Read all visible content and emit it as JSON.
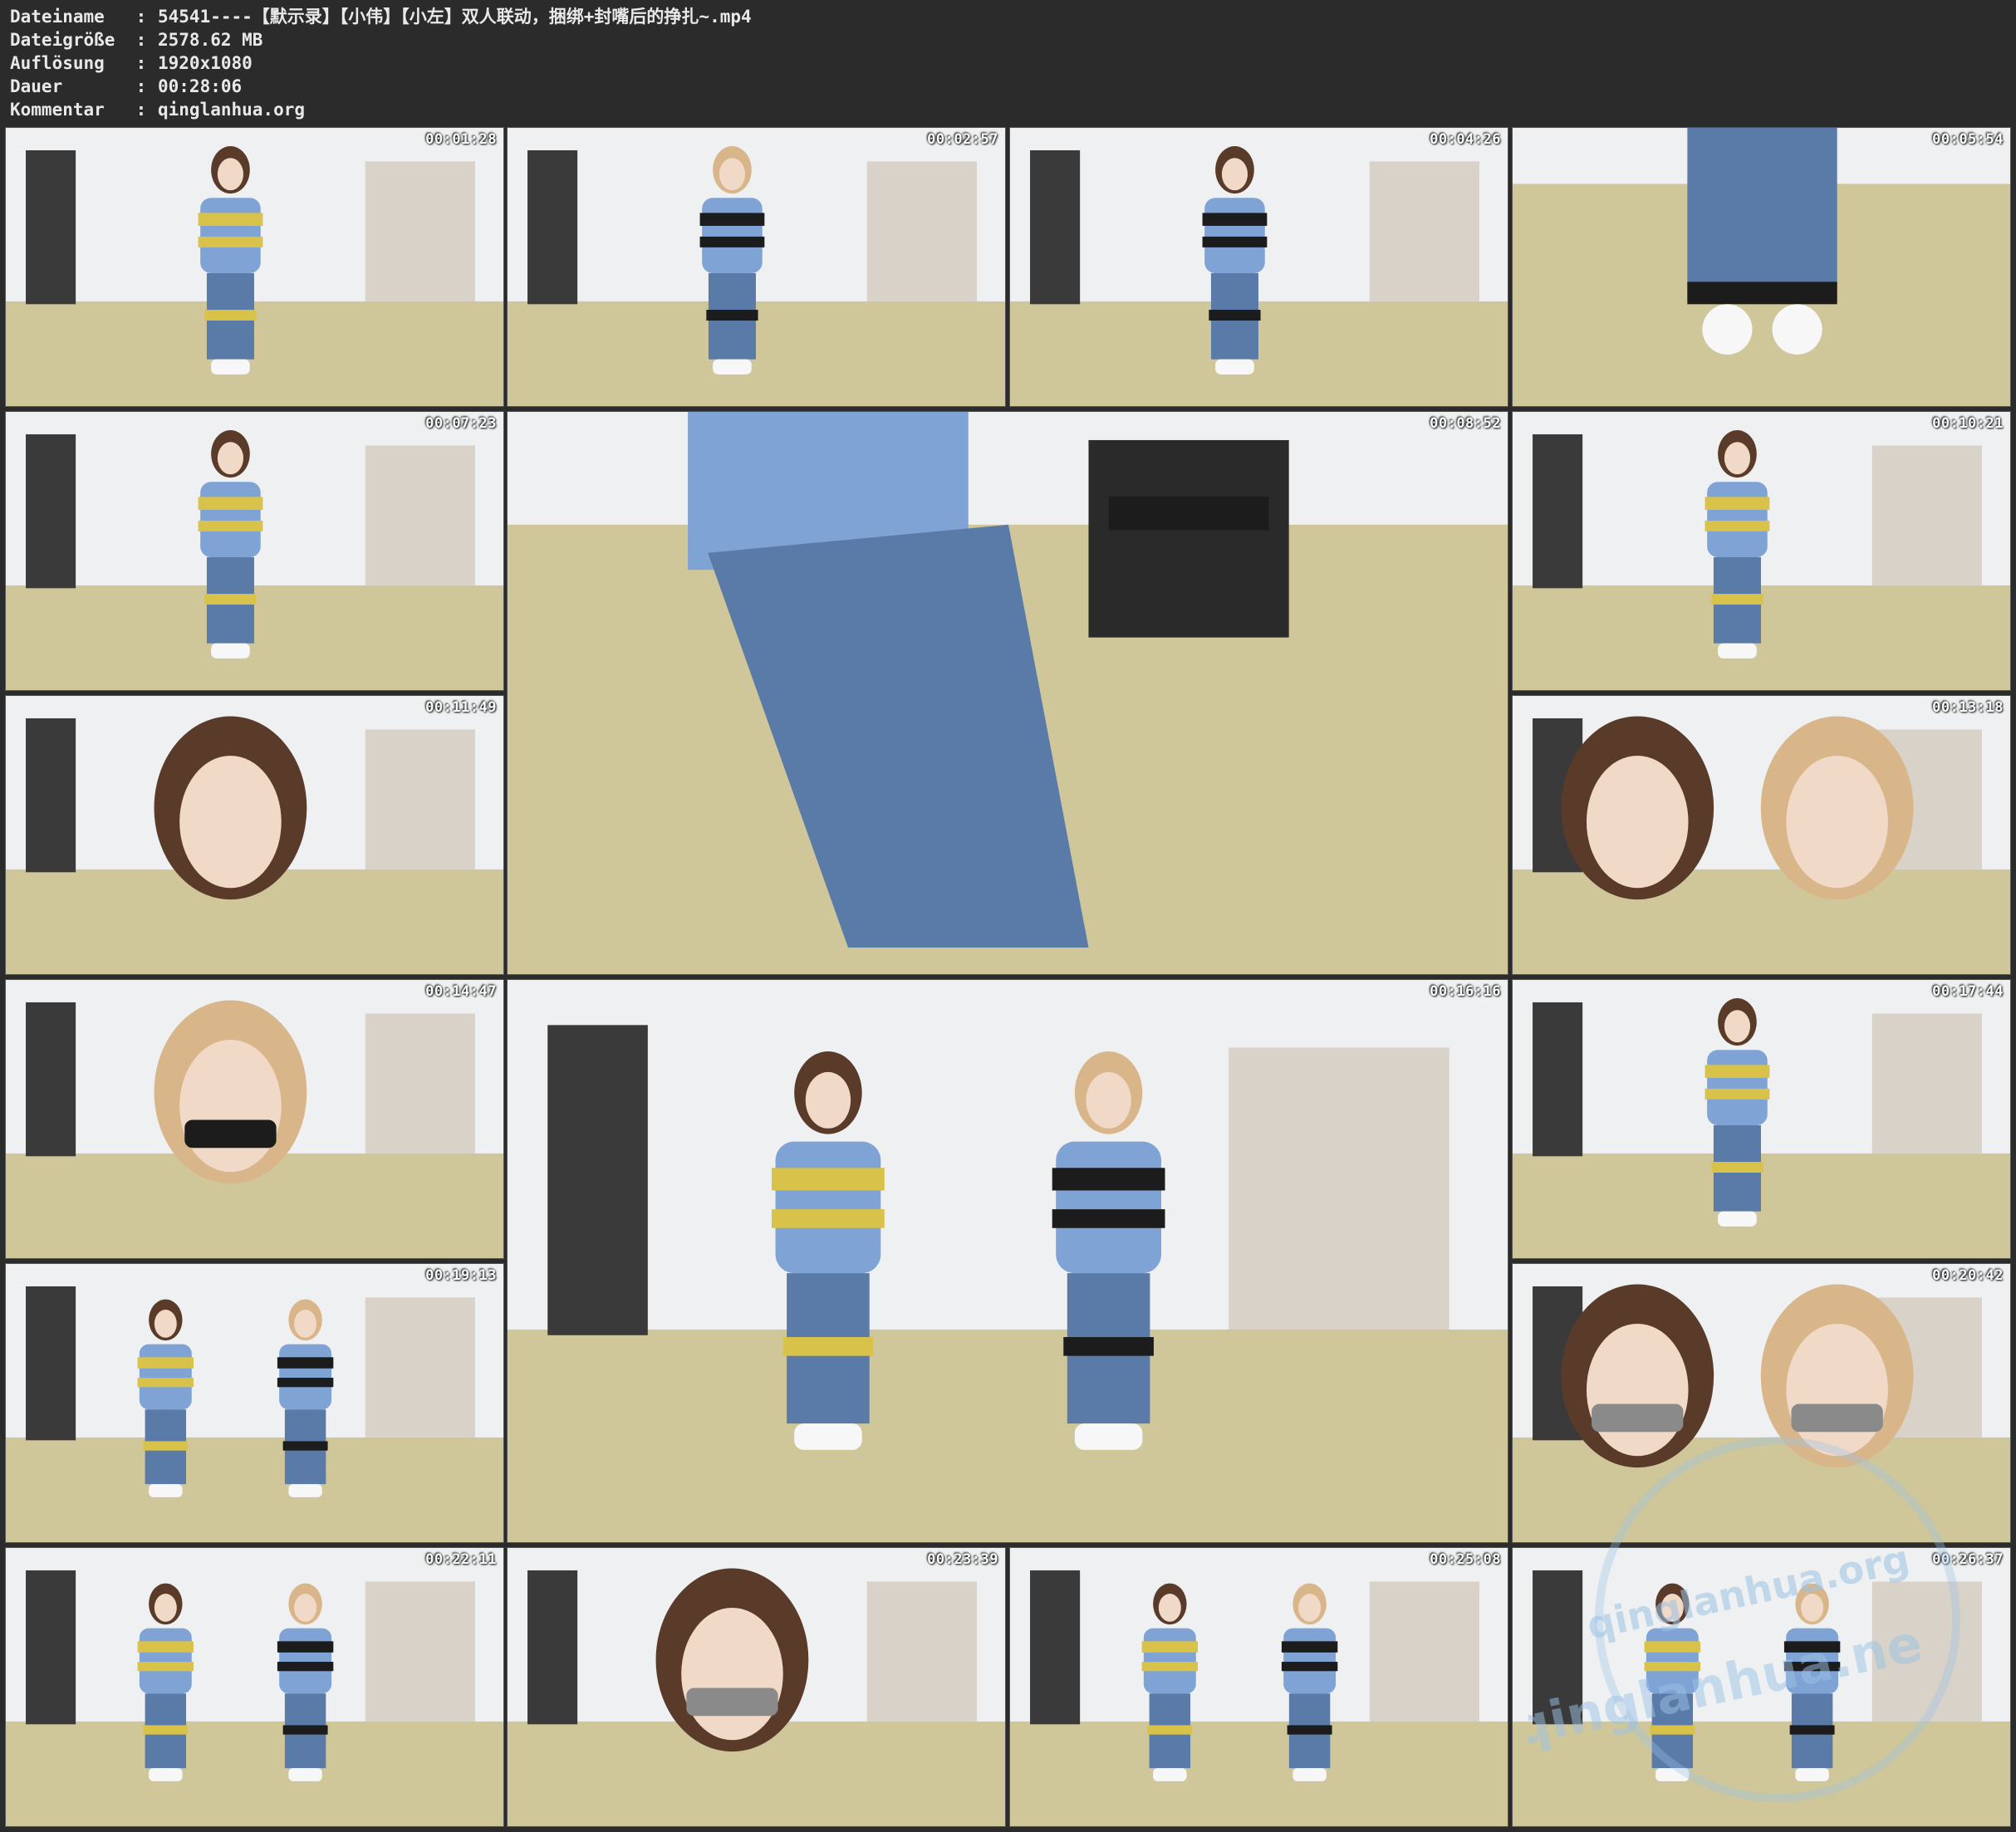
{
  "metadata": [
    {
      "key": "Dateiname",
      "value": "54541----【默示录】【小伟】【小左】双人联动，捆绑+封嘴后的挣扎~.mp4"
    },
    {
      "key": "Dateigröße",
      "value": "2578.62 MB"
    },
    {
      "key": "Auflösung",
      "value": "1920x1080"
    },
    {
      "key": "Dauer",
      "value": "00:28:06"
    },
    {
      "key": "Kommentar",
      "value": "qinglanhua.org"
    }
  ],
  "separator": ":",
  "thumbnails": [
    {
      "timestamp": "00:01:28",
      "scene": "hair-styling"
    },
    {
      "timestamp": "00:02:57",
      "scene": "seated-black-wrap"
    },
    {
      "timestamp": "00:04:26",
      "scene": "leg-taping"
    },
    {
      "timestamp": "00:05:54",
      "scene": "feet-closeup"
    },
    {
      "timestamp": "00:07:23",
      "scene": "yellow-wrap"
    },
    {
      "timestamp": "00:08:52",
      "scene": "jeans-closeup"
    },
    {
      "timestamp": "00:10:21",
      "scene": "knee-yellow-tape"
    },
    {
      "timestamp": "00:11:49",
      "scene": "face-closeup"
    },
    {
      "timestamp": "00:13:18",
      "scene": "two-faces"
    },
    {
      "timestamp": "00:14:47",
      "scene": "mouth-taping"
    },
    {
      "timestamp": "00:16:16",
      "scene": "two-seated-wide"
    },
    {
      "timestamp": "00:17:44",
      "scene": "lap-yellow-tape"
    },
    {
      "timestamp": "00:19:13",
      "scene": "two-seated-wide"
    },
    {
      "timestamp": "00:20:42",
      "scene": "two-faces-taped"
    },
    {
      "timestamp": "00:22:11",
      "scene": "two-seated-wide"
    },
    {
      "timestamp": "00:23:39",
      "scene": "profile-closeup"
    },
    {
      "timestamp": "00:25:08",
      "scene": "two-seated-wide"
    },
    {
      "timestamp": "00:26:37",
      "scene": "two-seated-wide"
    }
  ],
  "watermark_text": "qinglanhua.ne",
  "watermark_text_2": "qinglanhua.org",
  "colors": {
    "background": "#2b2b2b",
    "metadata_text": "#e8e8e8",
    "wall": "#eef0f1",
    "floor": "#cfc79a",
    "denim": "#5a7aa8",
    "yellow_tape": "#d9c24a",
    "black_tape": "#1c1c1c",
    "watermark": "#9cc3e6"
  }
}
